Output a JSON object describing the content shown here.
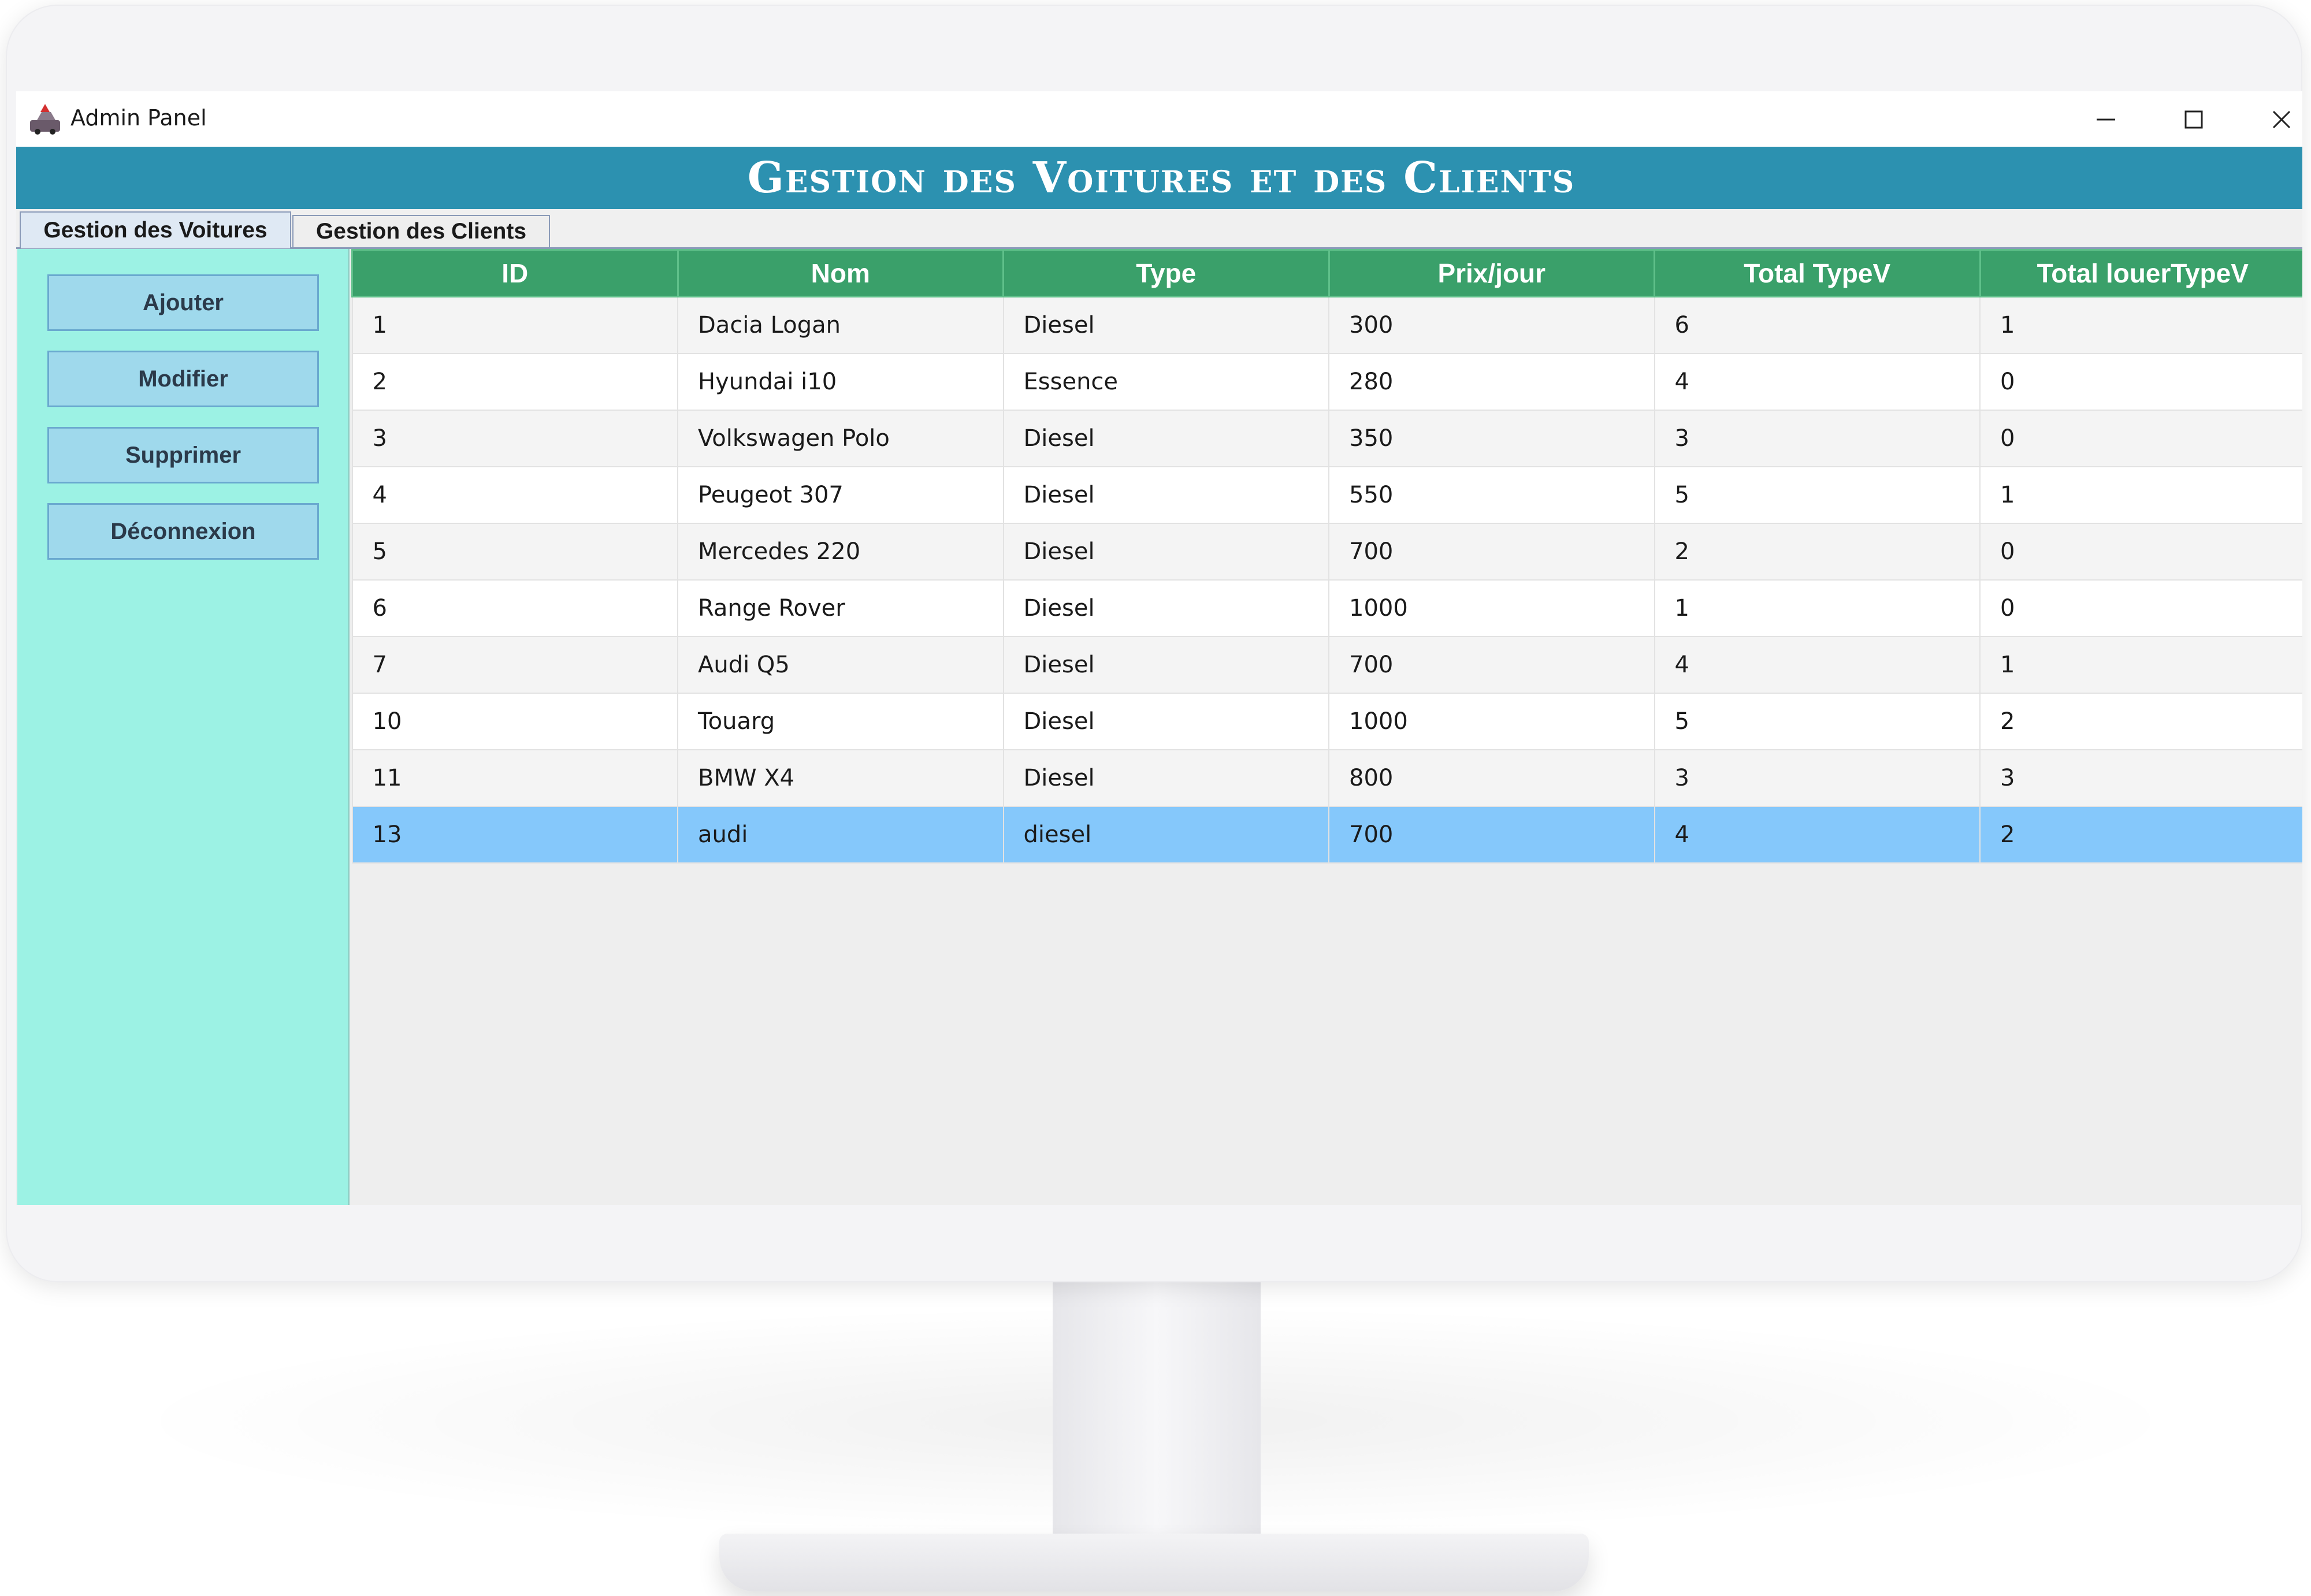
{
  "window": {
    "title": "Admin Panel",
    "minimize_glyph": "—",
    "maximize_glyph": "☐",
    "close_glyph": "✕",
    "app_icon": "car-warning-icon"
  },
  "banner": {
    "title": "Gestion des Voitures et des Clients"
  },
  "tabs": [
    {
      "label": "Gestion des Voitures",
      "active": true
    },
    {
      "label": "Gestion des Clients",
      "active": false
    }
  ],
  "sidebar": {
    "buttons": [
      {
        "label": "Ajouter"
      },
      {
        "label": "Modifier"
      },
      {
        "label": "Supprimer"
      },
      {
        "label": "Déconnexion"
      }
    ]
  },
  "table": {
    "columns": [
      "ID",
      "Nom",
      "Type",
      "Prix/jour",
      "Total TypeV",
      "Total louerTypeV"
    ],
    "rows": [
      [
        "1",
        "Dacia Logan",
        "Diesel",
        "300",
        "6",
        "1"
      ],
      [
        "2",
        "Hyundai i10",
        "Essence",
        "280",
        "4",
        "0"
      ],
      [
        "3",
        "Volkswagen Polo",
        "Diesel",
        "350",
        "3",
        "0"
      ],
      [
        "4",
        "Peugeot 307",
        "Diesel",
        "550",
        "5",
        "1"
      ],
      [
        "5",
        "Mercedes 220",
        "Diesel",
        "700",
        "2",
        "0"
      ],
      [
        "6",
        "Range Rover",
        "Diesel",
        "1000",
        "1",
        "0"
      ],
      [
        "7",
        "Audi Q5",
        "Diesel",
        "700",
        "4",
        "1"
      ],
      [
        "10",
        "Touarg",
        "Diesel",
        "1000",
        "5",
        "2"
      ],
      [
        "11",
        "BMW X4",
        "Diesel",
        "800",
        "3",
        "3"
      ],
      [
        "13",
        "audi",
        "diesel",
        "700",
        "4",
        "2"
      ]
    ],
    "selected_row": 9
  },
  "colors": {
    "banner": "#2c91b0",
    "header": "#3aa06a",
    "sidebar": "#9cf2e4",
    "selected_row": "#85c8fb"
  }
}
